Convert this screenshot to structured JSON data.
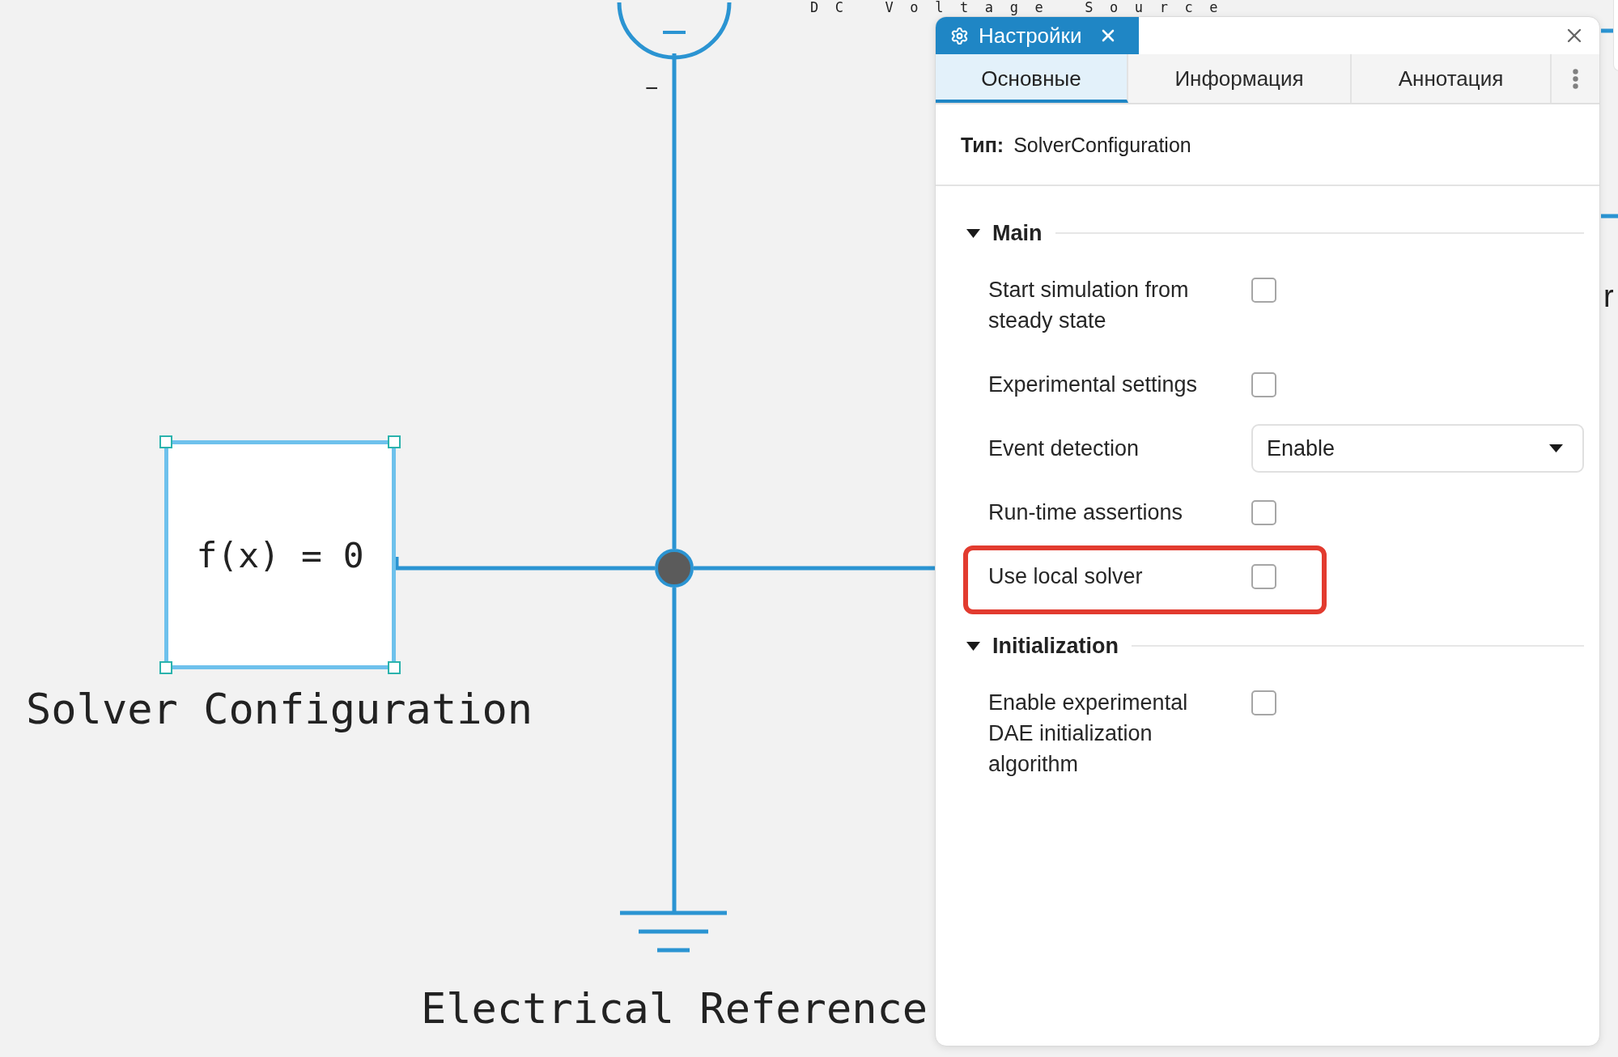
{
  "canvas": {
    "source_title": "DC Voltage Source",
    "source_port_label": "−",
    "solver_block": {
      "equation": "f(x) = 0",
      "selected": true
    },
    "solver_label": "Solver Configuration",
    "reference_label": "Electrical Reference",
    "right_label_fragment": "r"
  },
  "panel": {
    "window_tabs": [
      {
        "label": "Настройки",
        "selected": true
      }
    ],
    "tabs": [
      {
        "label": "Основные",
        "selected": true
      },
      {
        "label": "Информация",
        "selected": false
      },
      {
        "label": "Аннотация",
        "selected": false
      }
    ],
    "type": {
      "label": "Тип:",
      "value": "SolverConfiguration"
    },
    "sections": [
      {
        "title": "Main",
        "expanded": true,
        "rows": [
          {
            "kind": "checkbox",
            "label": "Start simulation from steady state",
            "checked": false,
            "highlighted": false
          },
          {
            "kind": "checkbox",
            "label": "Experimental settings",
            "checked": false,
            "highlighted": false
          },
          {
            "kind": "dropdown",
            "label": "Event detection",
            "value": "Enable",
            "highlighted": false
          },
          {
            "kind": "checkbox",
            "label": "Run-time assertions",
            "checked": false,
            "highlighted": false
          },
          {
            "kind": "checkbox",
            "label": "Use local solver",
            "checked": false,
            "highlighted": true
          }
        ]
      },
      {
        "title": "Initialization",
        "expanded": true,
        "rows": [
          {
            "kind": "checkbox",
            "label": "Enable experimental DAE initialization algorithm",
            "checked": false,
            "highlighted": false
          }
        ]
      }
    ]
  }
}
